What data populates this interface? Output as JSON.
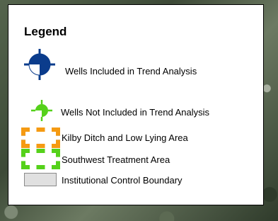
{
  "legend": {
    "title": "Legend",
    "items": [
      {
        "label": "Wells Included in Trend Analysis",
        "symbol": "well-included-icon",
        "color": "#0b3c8c"
      },
      {
        "label": "Wells Not Included in Trend Analysis",
        "symbol": "well-not-included-icon",
        "color": "#55d11a"
      },
      {
        "label": "Kilby Ditch and Low Lying Area",
        "symbol": "dashed-area-swatch",
        "colors": [
          "#1c5fd0",
          "#f59a12"
        ]
      },
      {
        "label": "Southwest Treatment Area",
        "symbol": "dashed-area-swatch",
        "colors": [
          "#55d11a",
          "#ffffff"
        ]
      },
      {
        "label": "Institutional Control Boundary",
        "symbol": "filled-area-swatch",
        "color": "#e0e0e0"
      }
    ]
  }
}
